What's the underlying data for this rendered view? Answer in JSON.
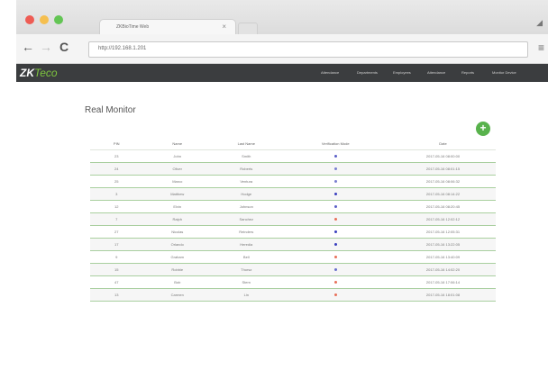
{
  "browser": {
    "tab_title": "ZKBioTime Web",
    "tab_close": "×",
    "url": "http://192.168.1.201",
    "traffic_lights": [
      "#ee5c54",
      "#f5bf4f",
      "#63c554"
    ]
  },
  "navbar": {
    "logo_main": "ZK",
    "logo_accent": "Teco",
    "links": [
      "Attendance",
      "Departments",
      "Employees",
      "Attendance",
      "Reports",
      "Monitor Device"
    ]
  },
  "page": {
    "title": "Real Monitor",
    "add_label": "+"
  },
  "table": {
    "headers": [
      "PIN",
      "Name",
      "Last Name",
      "Verification Mode",
      "Date"
    ],
    "rows": [
      [
        "23",
        "John",
        "Smith",
        "#5b5fc7",
        "2017-05-16 08:00:00"
      ],
      [
        "24",
        "Oliver",
        "Roberts",
        "#7a7fd0",
        "2017-05-16 08:01:15"
      ],
      [
        "25",
        "Marco",
        "Ventura",
        "#7a7fd0",
        "2017-05-16 08:06:32"
      ],
      [
        "3",
        "Matthew",
        "Hodge",
        "#3a3fbf",
        "2017-05-16 08:14:22"
      ],
      [
        "12",
        "Elvin",
        "Johnson",
        "#5b5fc7",
        "2017-05-16 08:20:45"
      ],
      [
        "7",
        "Ralph",
        "Sanchez",
        "#e8705a",
        "2017-05-16 12:02:12"
      ],
      [
        "27",
        "Nicolas",
        "Reinders",
        "#3a3fbf",
        "2017-05-16 12:05:31"
      ],
      [
        "17",
        "Orlando",
        "Heredia",
        "#3a3fbf",
        "2017-05-16 13:22:05"
      ],
      [
        "9",
        "Graham",
        "Bell",
        "#e8705a",
        "2017-05-16 13:40:09"
      ],
      [
        "15",
        "Robbie",
        "Thorsz",
        "#6a6fcc",
        "2017-05-16 14:02:20"
      ],
      [
        "47",
        "Bob",
        "Stern",
        "#e8705a",
        "2017-05-16 17:06:14"
      ],
      [
        "13",
        "Carmen",
        "Lin",
        "#e8705a",
        "2017-05-16 18:01:08"
      ]
    ]
  }
}
